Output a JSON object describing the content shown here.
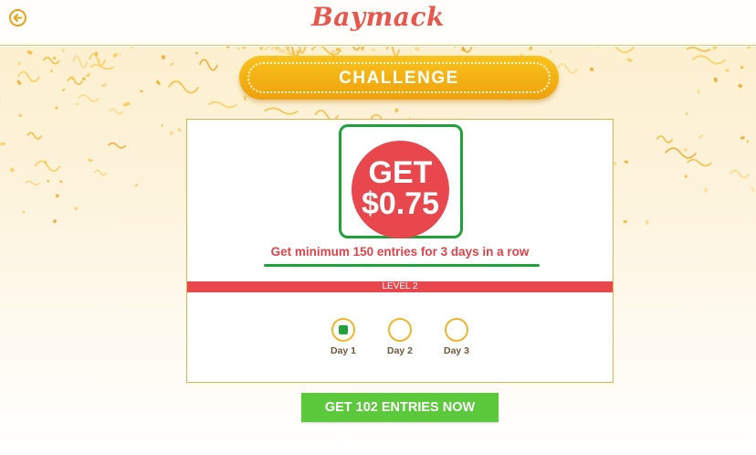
{
  "header": {
    "logo": "Baymack",
    "back_icon": "back-arrow-icon",
    "accent": "#e9a21a"
  },
  "banner": {
    "label": "CHALLENGE"
  },
  "reward": {
    "line1": "GET",
    "line2": "$0.75",
    "color": "#e8474d"
  },
  "condition": "Get minimum 150 entries for 3 days in a row",
  "level": "LEVEL 2",
  "days": [
    {
      "label": "Day 1",
      "completed": true
    },
    {
      "label": "Day 2",
      "completed": false
    },
    {
      "label": "Day 3",
      "completed": false
    }
  ],
  "cta": {
    "label": "GET 102 ENTRIES NOW",
    "color": "#5cc83b"
  },
  "colors": {
    "highlight": "#1fa23a",
    "confetti": "#f0b52a"
  }
}
